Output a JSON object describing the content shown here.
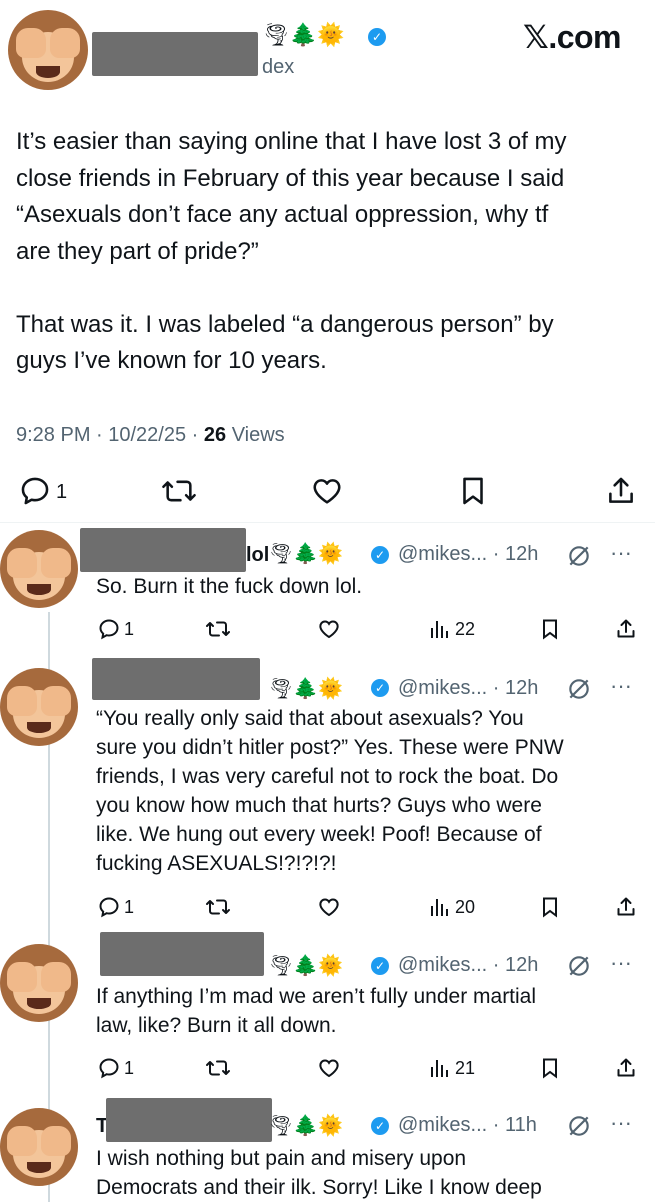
{
  "brand": "𝕏.com",
  "main_tweet": {
    "handle_partial": "dex",
    "name_emojis": "🌪🌲🌞",
    "body_lines": [
      "It’s easier than saying online that I have lost 3 of my",
      "close friends in February of this year because I said",
      "“Asexuals don’t face any actual oppression, why tf",
      "are they part of pride?”",
      "",
      "That was it. I was labeled “a dangerous person” by",
      "guys I’ve known for 10 years."
    ],
    "timestamp": "9:28 PM · 10/22/25 · ",
    "views_count": "26",
    "views_label": " Views",
    "reply_count": "1"
  },
  "replies": [
    {
      "name_partial": "lol",
      "handle": "@mikes...",
      "time": "· 12h",
      "body_lines": [
        "So. Burn it the fuck down lol."
      ],
      "reply_count": "1",
      "views": "22"
    },
    {
      "name_partial": "",
      "handle": "@mikes...",
      "time": "· 12h",
      "body_lines": [
        "“You really only said that about asexuals? You",
        "sure you didn’t hitler post?” Yes. These were PNW",
        "friends, I was very careful not to rock the boat. Do",
        "you know how much that hurts? Guys who were",
        "like. We hung out every week! Poof! Because of",
        "fucking ASEXUALS!?!?!?!"
      ],
      "reply_count": "1",
      "views": "20"
    },
    {
      "name_partial": "",
      "handle": "@mikes...",
      "time": "· 12h",
      "body_lines": [
        "If anything I’m mad we aren’t fully under martial",
        "law, like? Burn it all down."
      ],
      "reply_count": "1",
      "views": "21"
    },
    {
      "name_partial": "T",
      "handle": "@mikes...",
      "time": "· 11h",
      "body_lines": [
        "I wish nothing but pain and misery upon",
        "Democrats and their ilk. Sorry! Like I know deep"
      ]
    }
  ],
  "more_dots": "···",
  "verified_check": "✓"
}
